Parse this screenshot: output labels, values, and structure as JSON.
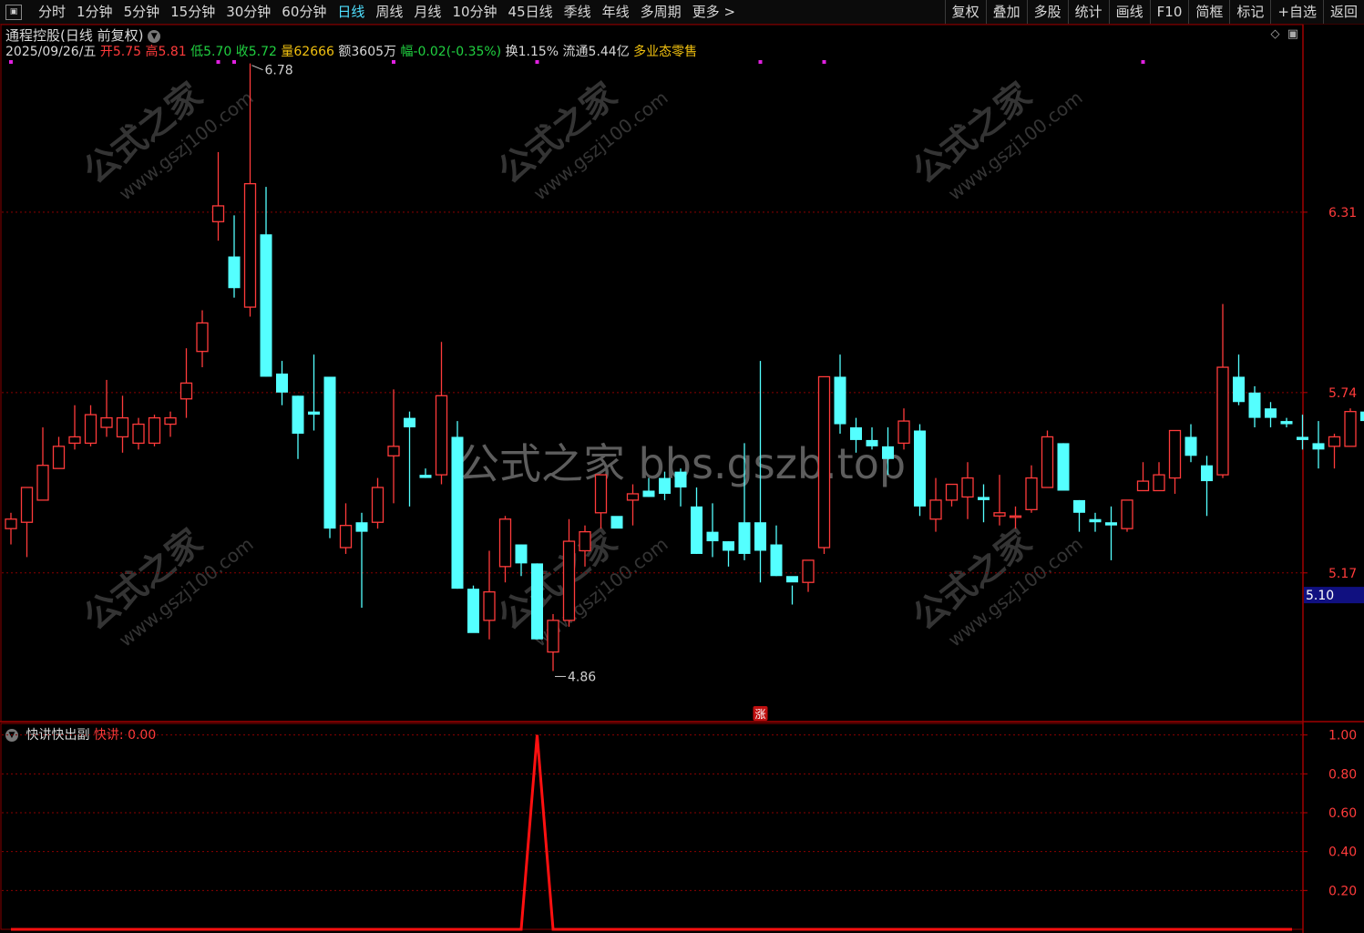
{
  "toolbar": {
    "periods": [
      "分时",
      "1分钟",
      "5分钟",
      "15分钟",
      "30分钟",
      "60分钟",
      "日线",
      "周线",
      "月线",
      "10分钟",
      "45日线",
      "季线",
      "年线",
      "多周期",
      "更多 >"
    ],
    "active_period": "日线",
    "right_buttons": [
      "复权",
      "叠加",
      "多股",
      "统计",
      "画线",
      "F10",
      "简框",
      "标记",
      "+自选",
      "返回"
    ]
  },
  "header": {
    "title": "通程控股(日线 前复权)",
    "date": "2025/09/26/五",
    "open_label": "开",
    "open": "5.75",
    "high_label": "高",
    "high": "5.81",
    "low_label": "低",
    "low": "5.70",
    "close_label": "收",
    "close": "5.72",
    "volume_label": "量",
    "volume": "62666",
    "amount_label": "额",
    "amount": "3605万",
    "change_label": "幅",
    "change": "-0.02(-0.35%)",
    "turnover_label": "换",
    "turnover": "1.15%",
    "float_label": "流通",
    "float_cap": "5.44亿",
    "sector": "多业态零售"
  },
  "colors": {
    "up": "#ff3b3b",
    "down": "#54ffff",
    "grid": "#8a0000",
    "signal": "#ff1010",
    "marker": "#e020e0"
  },
  "chart_data": [
    {
      "type": "candlestick",
      "ylim": [
        4.7,
        6.9
      ],
      "y_ticks": [
        "6.31",
        "5.74",
        "5.17"
      ],
      "y_tick_values": [
        6.31,
        5.74,
        5.17
      ],
      "current_price_label": "5.10",
      "current_price": 5.1,
      "max_label": "6.78",
      "min_label": "4.86",
      "badge": "涨",
      "candles": [
        [
          5.31,
          5.34,
          5.26,
          5.36
        ],
        [
          5.33,
          5.44,
          5.22,
          5.44
        ],
        [
          5.4,
          5.51,
          5.4,
          5.63
        ],
        [
          5.5,
          5.57,
          5.5,
          5.6
        ],
        [
          5.58,
          5.6,
          5.56,
          5.7
        ],
        [
          5.58,
          5.67,
          5.57,
          5.7
        ],
        [
          5.63,
          5.66,
          5.6,
          5.78
        ],
        [
          5.6,
          5.66,
          5.55,
          5.73
        ],
        [
          5.58,
          5.64,
          5.56,
          5.66
        ],
        [
          5.58,
          5.66,
          5.57,
          5.67
        ],
        [
          5.64,
          5.66,
          5.6,
          5.68
        ],
        [
          5.72,
          5.77,
          5.66,
          5.88
        ],
        [
          5.87,
          5.96,
          5.82,
          6.0
        ],
        [
          6.28,
          6.33,
          6.22,
          6.5
        ],
        [
          6.17,
          6.07,
          6.04,
          6.3
        ],
        [
          6.01,
          6.4,
          5.98,
          6.78
        ],
        [
          6.24,
          5.79,
          5.79,
          6.39
        ],
        [
          5.8,
          5.74,
          5.7,
          5.84
        ],
        [
          5.73,
          5.61,
          5.53,
          5.73
        ],
        [
          5.68,
          5.67,
          5.62,
          5.86
        ],
        [
          5.79,
          5.31,
          5.28,
          5.79
        ],
        [
          5.25,
          5.32,
          5.23,
          5.39
        ],
        [
          5.33,
          5.3,
          5.06,
          5.36
        ],
        [
          5.33,
          5.44,
          5.31,
          5.47
        ],
        [
          5.54,
          5.57,
          5.39,
          5.75
        ],
        [
          5.66,
          5.63,
          5.38,
          5.68
        ],
        [
          5.48,
          5.47,
          5.47,
          5.5
        ],
        [
          5.48,
          5.73,
          5.45,
          5.9
        ],
        [
          5.6,
          5.12,
          5.12,
          5.65
        ],
        [
          5.12,
          4.98,
          4.99,
          5.13
        ],
        [
          5.02,
          5.11,
          4.96,
          5.24
        ],
        [
          5.19,
          5.34,
          5.14,
          5.35
        ],
        [
          5.26,
          5.2,
          5.16,
          5.26
        ],
        [
          5.2,
          4.96,
          4.96,
          5.2
        ],
        [
          4.92,
          5.02,
          4.86,
          5.04
        ],
        [
          5.02,
          5.27,
          5.0,
          5.34
        ],
        [
          5.24,
          5.3,
          5.19,
          5.32
        ],
        [
          5.36,
          5.48,
          5.31,
          5.48
        ],
        [
          5.35,
          5.31,
          5.31,
          5.31
        ],
        [
          5.4,
          5.42,
          5.32,
          5.45
        ],
        [
          5.43,
          5.41,
          5.41,
          5.47
        ],
        [
          5.47,
          5.42,
          5.4,
          5.49
        ],
        [
          5.49,
          5.44,
          5.38,
          5.5
        ],
        [
          5.38,
          5.23,
          5.23,
          5.44
        ],
        [
          5.3,
          5.27,
          5.22,
          5.39
        ],
        [
          5.27,
          5.24,
          5.19,
          5.27
        ],
        [
          5.33,
          5.23,
          5.21,
          5.58
        ],
        [
          5.33,
          5.24,
          5.14,
          5.84
        ],
        [
          5.26,
          5.16,
          5.16,
          5.32
        ],
        [
          5.16,
          5.14,
          5.07,
          5.13
        ],
        [
          5.14,
          5.21,
          5.11,
          5.21
        ],
        [
          5.25,
          5.79,
          5.23,
          5.79
        ],
        [
          5.79,
          5.64,
          5.61,
          5.86
        ],
        [
          5.63,
          5.59,
          5.55,
          5.66
        ],
        [
          5.59,
          5.57,
          5.56,
          5.63
        ],
        [
          5.57,
          5.53,
          5.48,
          5.63
        ],
        [
          5.58,
          5.65,
          5.56,
          5.69
        ],
        [
          5.62,
          5.38,
          5.35,
          5.64
        ],
        [
          5.34,
          5.4,
          5.3,
          5.47
        ],
        [
          5.4,
          5.45,
          5.38,
          5.45
        ],
        [
          5.41,
          5.47,
          5.34,
          5.52
        ],
        [
          5.41,
          5.4,
          5.33,
          5.45
        ],
        [
          5.35,
          5.36,
          5.32,
          5.48
        ],
        [
          5.35,
          5.35,
          5.31,
          5.38
        ],
        [
          5.37,
          5.47,
          5.36,
          5.51
        ],
        [
          5.44,
          5.6,
          5.44,
          5.62
        ],
        [
          5.58,
          5.43,
          5.43,
          5.58
        ],
        [
          5.4,
          5.36,
          5.3,
          5.4
        ],
        [
          5.34,
          5.33,
          5.3,
          5.36
        ],
        [
          5.33,
          5.32,
          5.21,
          5.38
        ],
        [
          5.31,
          5.4,
          5.3,
          5.4
        ],
        [
          5.43,
          5.46,
          5.43,
          5.52
        ],
        [
          5.43,
          5.48,
          5.43,
          5.52
        ],
        [
          5.47,
          5.62,
          5.42,
          5.62
        ],
        [
          5.6,
          5.54,
          5.52,
          5.64
        ],
        [
          5.51,
          5.46,
          5.35,
          5.54
        ],
        [
          5.48,
          5.82,
          5.47,
          6.02
        ],
        [
          5.79,
          5.71,
          5.7,
          5.86
        ],
        [
          5.74,
          5.66,
          5.63,
          5.76
        ],
        [
          5.69,
          5.66,
          5.63,
          5.71
        ],
        [
          5.65,
          5.64,
          5.63,
          5.66
        ],
        [
          5.6,
          5.59,
          5.56,
          5.67
        ],
        [
          5.58,
          5.56,
          5.5,
          5.65
        ],
        [
          5.57,
          5.6,
          5.5,
          5.61
        ],
        [
          5.57,
          5.68,
          5.57,
          5.69
        ],
        [
          5.68,
          5.65,
          5.6,
          5.69
        ],
        [
          5.63,
          5.59,
          5.49,
          5.63
        ]
      ],
      "markers": [
        0,
        13,
        14,
        24,
        33,
        47,
        51,
        71
      ]
    },
    {
      "type": "line",
      "title": "快讲快出副",
      "series_label": "快讲:",
      "series_value": "0.00",
      "ylim": [
        0,
        1.05
      ],
      "y_ticks": [
        "1.00",
        "0.80",
        "0.60",
        "0.40",
        "0.20"
      ],
      "y_tick_values": [
        1.0,
        0.8,
        0.6,
        0.4,
        0.2
      ],
      "signal_index": 33,
      "count": 81
    }
  ],
  "watermarks": {
    "diag": "公式之家",
    "diag_url": "www.gszj100.com",
    "center": "公式之家 bbs.gszb.top"
  }
}
